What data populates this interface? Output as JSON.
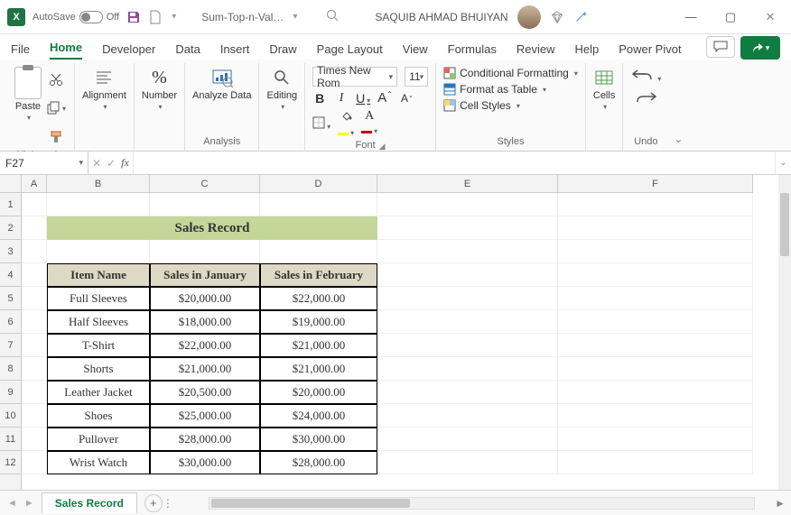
{
  "titlebar": {
    "autosave": "AutoSave",
    "autosave_state": "Off",
    "filename": "Sum-Top-n-Val…",
    "user": "SAQUIB AHMAD BHUIYAN"
  },
  "tabs": {
    "file": "File",
    "home": "Home",
    "developer": "Developer",
    "data": "Data",
    "insert": "Insert",
    "draw": "Draw",
    "page_layout": "Page Layout",
    "view": "View",
    "formulas": "Formulas",
    "review": "Review",
    "help": "Help",
    "power_pivot": "Power Pivot"
  },
  "ribbon": {
    "clipboard": {
      "paste": "Paste",
      "group": "Clipboard"
    },
    "alignment": {
      "btn": "Alignment"
    },
    "number": {
      "btn": "Number"
    },
    "analysis": {
      "btn": "Analyze Data",
      "group": "Analysis"
    },
    "editing": {
      "btn": "Editing"
    },
    "font": {
      "name": "Times New Rom",
      "size": "11",
      "bold": "B",
      "italic": "I",
      "underline": "U",
      "incr": "A",
      "decr": "A",
      "group": "Font"
    },
    "styles": {
      "cond": "Conditional Formatting",
      "table": "Format as Table",
      "cell": "Cell Styles",
      "group": "Styles"
    },
    "cells": {
      "btn": "Cells"
    },
    "undo": {
      "group": "Undo"
    }
  },
  "formula": {
    "name_box": "F27",
    "fx": "fx",
    "value": ""
  },
  "columns": [
    "A",
    "B",
    "C",
    "D",
    "E",
    "F"
  ],
  "rows": [
    "1",
    "2",
    "3",
    "4",
    "5",
    "6",
    "7",
    "8",
    "9",
    "10",
    "11",
    "12"
  ],
  "sheet": {
    "title": "Sales Record",
    "headers": [
      "Item Name",
      "Sales in January",
      "Sales in February"
    ],
    "data": [
      [
        "Full Sleeves",
        "$20,000.00",
        "$22,000.00"
      ],
      [
        "Half Sleeves",
        "$18,000.00",
        "$19,000.00"
      ],
      [
        "T-Shirt",
        "$22,000.00",
        "$21,000.00"
      ],
      [
        "Shorts",
        "$21,000.00",
        "$21,000.00"
      ],
      [
        "Leather Jacket",
        "$20,500.00",
        "$20,000.00"
      ],
      [
        "Shoes",
        "$25,000.00",
        "$24,000.00"
      ],
      [
        "Pullover",
        "$28,000.00",
        "$30,000.00"
      ],
      [
        "Wrist Watch",
        "$30,000.00",
        "$28,000.00"
      ]
    ]
  },
  "sheettab": {
    "name": "Sales Record"
  }
}
